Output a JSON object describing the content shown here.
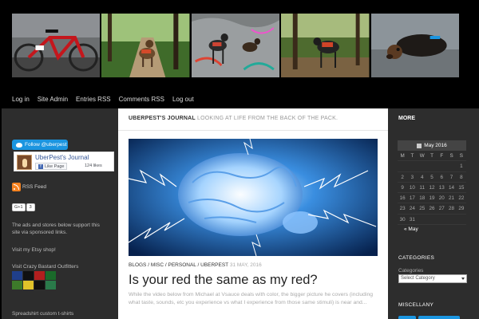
{
  "header": {
    "photos": [
      "bicycle-photo",
      "trail-dog-photo",
      "graffiti-dogs-photo",
      "forest-dog-photo",
      "resting-dog-photo"
    ]
  },
  "topnav": [
    "Log in",
    "Site Admin",
    "Entries RSS",
    "Comments RSS",
    "Log out"
  ],
  "left_sidebar": {
    "twitter_follow": "Follow @uberpest",
    "fb_page_name": "UberPest's Journal",
    "fb_like": "Like Page",
    "fb_likes": "124 likes",
    "rss_feed": "RSS Feed",
    "gplus_label": "G+1",
    "gplus_count": "3",
    "ads_text": "The ads and stores below support this site via sponsored links.",
    "etsy_text": "Visit my Etsy shop!",
    "crazy_text": "Visit Crazy Bastard Outfitters",
    "spreadshirt_text": "Spreadshirt custom t-shirts"
  },
  "main": {
    "site_title": "UBERPEST'S JOURNAL",
    "tagline": "LOOKING AT LIFE FROM THE BACK OF THE PACK.",
    "categories": [
      "BLOGS",
      "MISC",
      "PERSONAL",
      "UBERPEST"
    ],
    "post_date": "31 MAY, 2016",
    "post_title": "Is your red the same as my red?",
    "excerpt": "While the video below from Michael at Vsauce deals with color, the bigger picture he covers (including what taste, sounds, etc you experience vs what I experience from those same stimuli) is near and..."
  },
  "right_sidebar": {
    "more_label": "MORE",
    "calendar_title": "May 2016",
    "day_headers": [
      "M",
      "T",
      "W",
      "T",
      "F",
      "S",
      "S"
    ],
    "weeks": [
      [
        "",
        "",
        "",
        "",
        "",
        "",
        "1"
      ],
      [
        "2",
        "3",
        "4",
        "5",
        "6",
        "7",
        "8"
      ],
      [
        "9",
        "10",
        "11",
        "12",
        "13",
        "14",
        "15"
      ],
      [
        "16",
        "17",
        "18",
        "19",
        "20",
        "21",
        "22"
      ],
      [
        "23",
        "24",
        "25",
        "26",
        "27",
        "28",
        "29"
      ],
      [
        "30",
        "31",
        "",
        "",
        "",
        "",
        ""
      ]
    ],
    "prev_month": "« May",
    "categories_title": "CATEGORIES",
    "categories_label": "Categories",
    "select_placeholder": "Select Category",
    "misc_title": "MISCELLANY"
  },
  "colors": {
    "twitter": "#1b95e0",
    "facebook": "#4267b2",
    "rss": "#f58220",
    "sidebar_bg": "#2d2d2d"
  }
}
